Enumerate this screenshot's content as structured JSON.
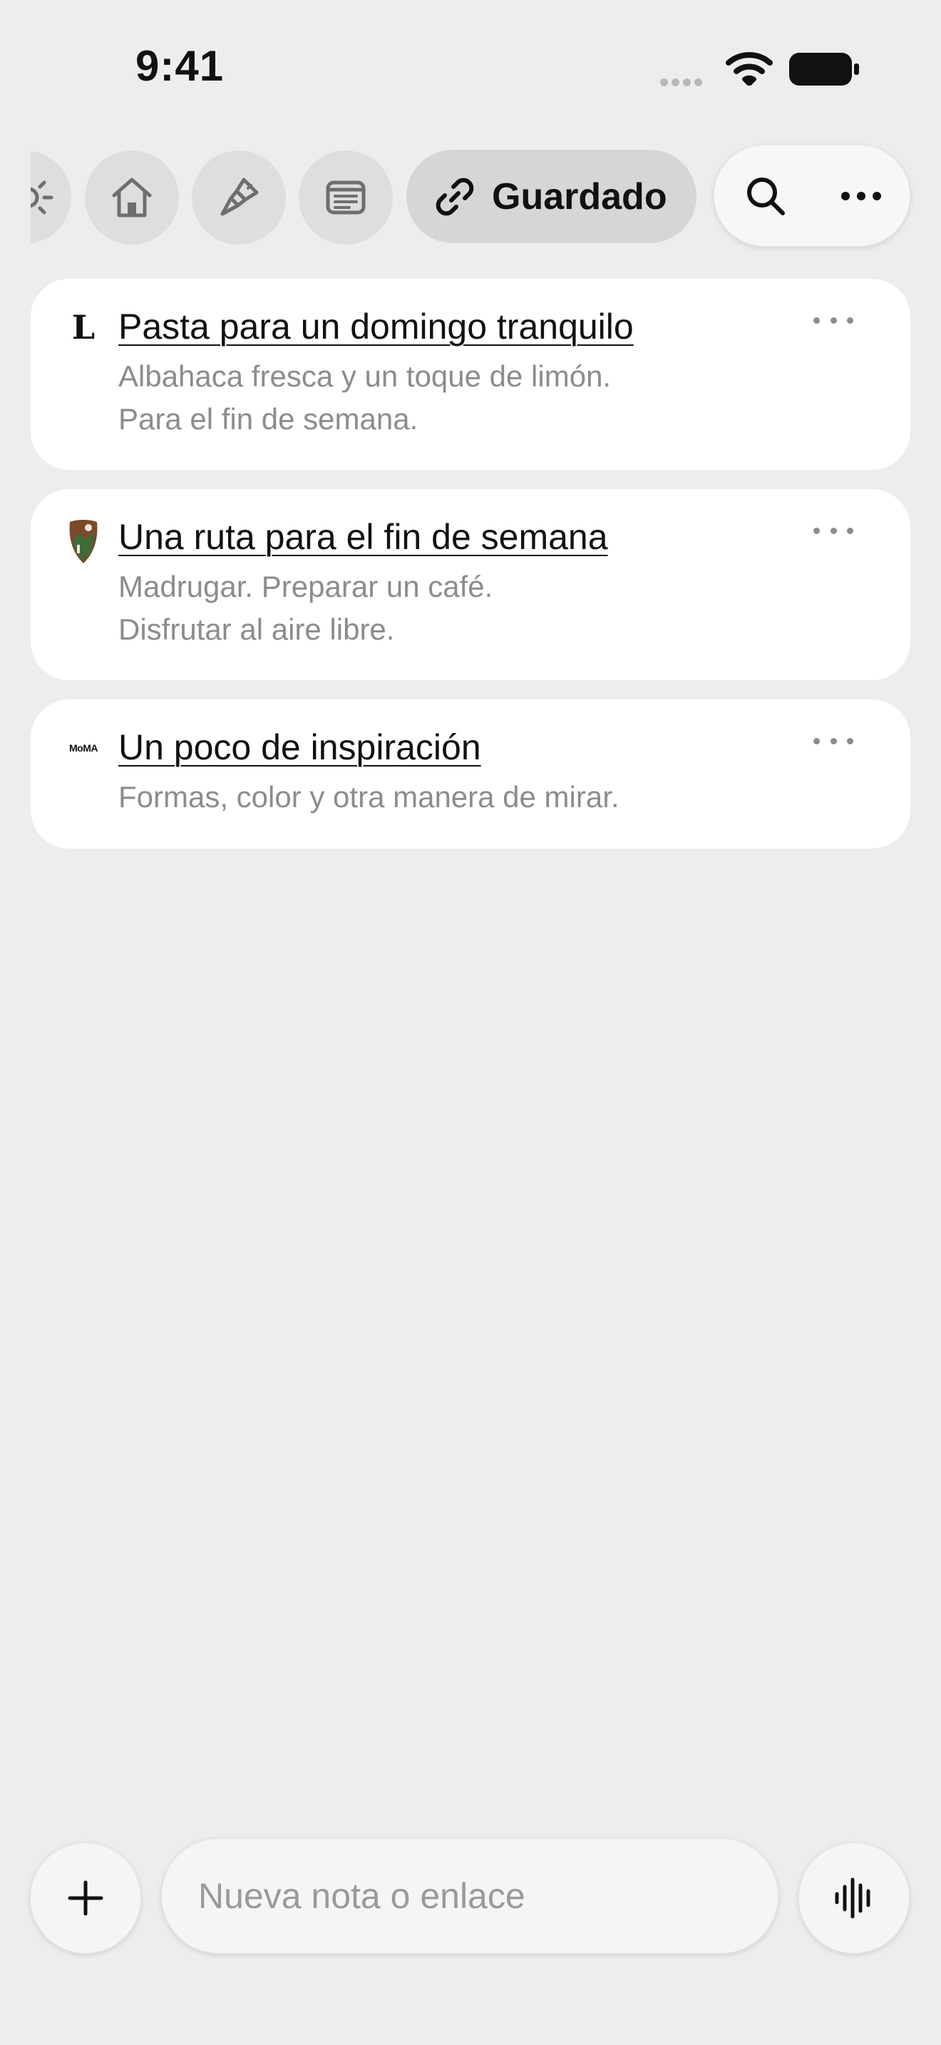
{
  "status_bar": {
    "time": "9:41"
  },
  "toolbar": {
    "icons": [
      "sun-icon",
      "home-icon",
      "brush-icon",
      "notes-icon"
    ],
    "saved_chip": {
      "icon": "link-icon",
      "label": "Guardado"
    },
    "search_icon": "search-icon",
    "menu_icon": "ellipsis-icon"
  },
  "cards": [
    {
      "favicon": "L",
      "title": "Pasta para un domingo tranquilo",
      "lines": [
        "Albahaca fresca y un toque de limón.",
        "Para el fin de semana."
      ]
    },
    {
      "favicon": "park-arrowhead-icon",
      "title": "Una ruta para el fin de semana",
      "lines": [
        "Madrugar. Preparar un café.",
        "Disfrutar al aire libre."
      ]
    },
    {
      "favicon": "MoMA",
      "title": "Un poco de inspiración",
      "lines": [
        "Formas, color y otra manera de mirar."
      ]
    }
  ],
  "composer": {
    "placeholder": "Nueva nota o enlace",
    "add_icon": "plus-icon",
    "voice_icon": "waveform-icon"
  }
}
